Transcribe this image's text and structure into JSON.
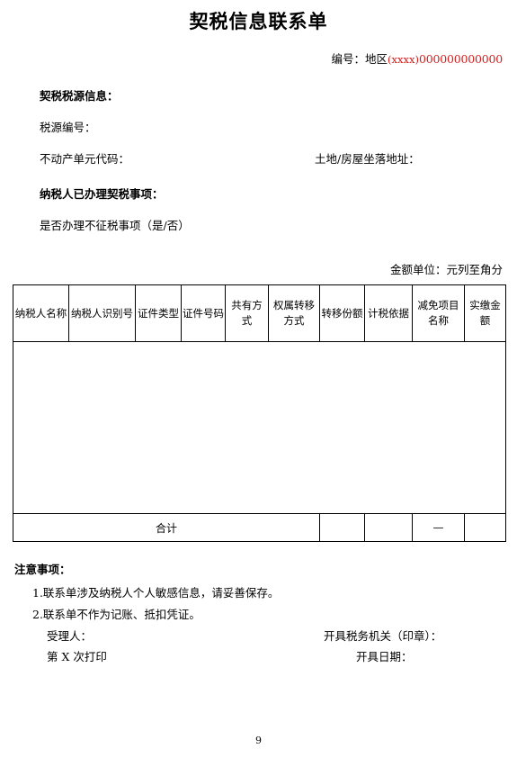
{
  "document": {
    "title": "契税信息联系单",
    "page_number": "9"
  },
  "serial": {
    "label": "编号：",
    "prefix": "地区",
    "region_code": "(xxxx)",
    "number": "000000000000",
    "color": "#d41c1c"
  },
  "tax_source_section": {
    "heading": "契税税源信息：",
    "fields": [
      {
        "label": "税源编号："
      },
      {
        "label": "不动产单元代码：",
        "right_label": "土地/房屋坐落地址："
      }
    ]
  },
  "taxpayer_section": {
    "heading": "纳税人已办理契税事项：",
    "fields": [
      {
        "label": "是否办理不征税事项（是/否）"
      }
    ]
  },
  "amount_unit": {
    "text": "金额单位：元列至角分"
  },
  "table": {
    "columns": [
      "纳税人名称",
      "纳税人识别号",
      "证件类型",
      "证件号码",
      "共有方式",
      "权属转移方式",
      "转移份额",
      "计税依据",
      "减免项目名称",
      "实缴金额"
    ],
    "rows": [],
    "total_row": {
      "label": "合计",
      "label_colspan": 6,
      "cells": [
        "",
        "",
        "—",
        ""
      ]
    }
  },
  "notes": {
    "heading": "注意事项：",
    "items": [
      "1.联系单涉及纳税人个人敏感信息，请妥善保存。",
      "2.联系单不作为记账、抵扣凭证。"
    ],
    "signatures": [
      {
        "left": "受理人：",
        "right": "开具税务机关（印章）："
      },
      {
        "left": "第 X 次打印",
        "right": "开具日期："
      }
    ]
  }
}
